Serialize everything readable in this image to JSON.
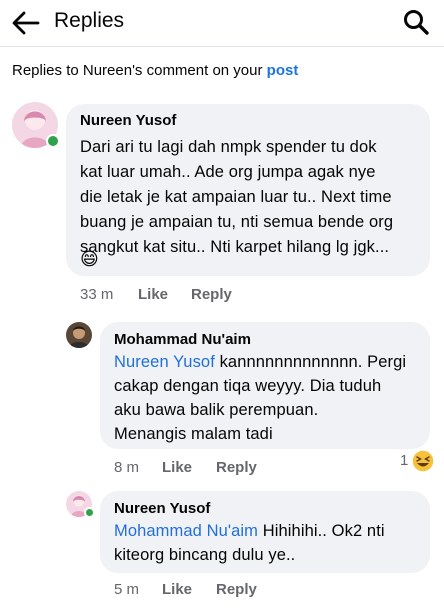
{
  "header": {
    "title": "Replies"
  },
  "context": {
    "prefix": "Replies to Nureen's comment on your ",
    "link": "post"
  },
  "comments": [
    {
      "author": "Nureen Yusof",
      "lines": [
        "Dari ari tu lagi dah nmpk spender tu dok",
        "kat luar umah.. Ade org jumpa agak nye",
        "die letak je kat ampaian luar tu.. Next time",
        "buang je ampaian tu, nti semua bende org",
        "sangkut kat situ.. Nti karpet hilang lg jgk...",
        "😄"
      ],
      "time": "33 m",
      "like": "Like",
      "reply": "Reply"
    },
    {
      "author": "Mohammad Nu'aim",
      "mention": "Nureen Yusof",
      "lines": [
        " kannnnnnnnnnnnn. Pergi",
        "cakap dengan tiqa weyyy. Dia tuduh",
        "aku bawa balik perempuan.",
        "Menangis malam tadi"
      ],
      "time": "8 m",
      "like": "Like",
      "reply": "Reply",
      "reaction_count": "1",
      "reaction_icon": "laughing-emoji-icon"
    },
    {
      "author": "Nureen Yusof",
      "mention": "Mohammad Nu'aim",
      "lines": [
        " Hihihihi.. Ok2 nti",
        "kiteorg bincang dulu ye.."
      ],
      "time": "5 m",
      "like": "Like",
      "reply": "Reply"
    }
  ],
  "colors": {
    "link": "#1b74e4",
    "mention": "#216fdb",
    "bubble": "#f0f2f5",
    "meta": "#65676b",
    "online": "#31a24c"
  }
}
